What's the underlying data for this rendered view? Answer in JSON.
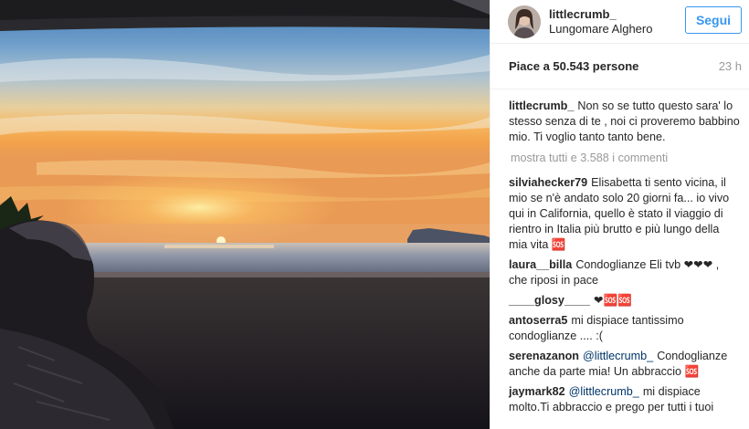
{
  "post": {
    "username": "littlecrumb_",
    "location": "Lungomare Alghero",
    "follow_label": "Segui",
    "likes_text": "Piace a 50.543 persone",
    "time_ago": "23 h",
    "caption": {
      "author": "littlecrumb_",
      "text": "Non so se tutto questo sara' lo stesso senza di te , noi ci proveremo babbino mio. Ti voglio tanto tanto bene."
    },
    "load_more": "mostra tutti e 3.588 i commenti",
    "comments": [
      {
        "author": "silviahecker79",
        "mention": "",
        "text": "Elisabetta ti sento vicina, il mio se n'è andato solo 20 giorni fa... io vivo qui in California, quello è stato il viaggio di rientro in Italia più brutto e più lungo della mia vita 🆘"
      },
      {
        "author": "laura__billa",
        "mention": "",
        "text": "Condoglianze Eli tvb ❤❤❤ , che riposi in pace"
      },
      {
        "author": "____glosy____",
        "mention": "",
        "text": "❤🆘🆘"
      },
      {
        "author": "antoserra5",
        "mention": "",
        "text": "mi dispiace tantissimo condoglianze .... :("
      },
      {
        "author": "serenazanon",
        "mention": "@littlecrumb_",
        "text": "Condoglianze anche da parte mia! Un abbraccio 🆘"
      },
      {
        "author": "jaymark82",
        "mention": "@littlecrumb_",
        "text": "mi dispiace molto.Ti abbraccio e prego per tutti i tuoi"
      }
    ]
  },
  "colors": {
    "accent": "#3897f0",
    "mention": "#003569",
    "muted": "#999999",
    "text": "#262626"
  }
}
